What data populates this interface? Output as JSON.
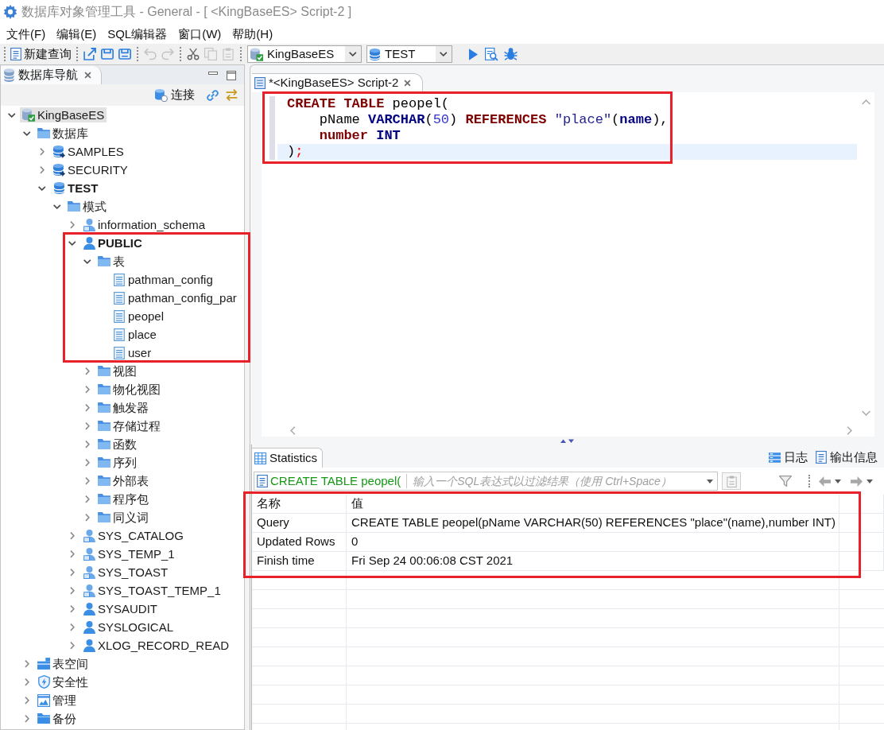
{
  "window": {
    "title": "数据库对象管理工具 - General - [ <KingBaseES> Script-2 ]"
  },
  "menu": [
    "文件(F)",
    "编辑(E)",
    "SQL编辑器",
    "窗口(W)",
    "帮助(H)"
  ],
  "toolbar": {
    "new_query": "新建查询",
    "groups": [
      [
        {
          "kind": "export",
          "disabled": false
        },
        {
          "kind": "save",
          "disabled": false
        },
        {
          "kind": "save_all",
          "disabled": false
        }
      ],
      [
        {
          "kind": "undo",
          "disabled": true
        },
        {
          "kind": "redo",
          "disabled": true
        }
      ],
      [
        {
          "kind": "cut",
          "disabled": false
        },
        {
          "kind": "copy",
          "disabled": true
        },
        {
          "kind": "paste",
          "disabled": true
        }
      ]
    ],
    "connection": "KingBaseES",
    "database": "TEST"
  },
  "navigator": {
    "tabs": [
      {
        "label": "数据库导航",
        "selected": true
      }
    ],
    "connect": "连接",
    "tree": [
      {
        "label": "KingBaseES",
        "kind": "server",
        "expanded": true,
        "selected": true,
        "children": [
          {
            "label": "数据库",
            "kind": "folder",
            "expanded": true,
            "selected": false,
            "children": [
              {
                "label": "SAMPLES",
                "kind": "database",
                "expanded": false,
                "selected": false,
                "active": false
              },
              {
                "label": "SECURITY",
                "kind": "database",
                "expanded": false,
                "selected": false,
                "active": false
              },
              {
                "label": "TEST",
                "kind": "database",
                "expanded": true,
                "selected": false,
                "active": true,
                "children": [
                  {
                    "label": "模式",
                    "kind": "folder",
                    "expanded": true,
                    "selected": false,
                    "children": [
                      {
                        "label": "information_schema",
                        "kind": "sysschema",
                        "expanded": false,
                        "selected": false,
                        "active": false
                      },
                      {
                        "label": "PUBLIC",
                        "kind": "schema",
                        "expanded": true,
                        "selected": false,
                        "active": true,
                        "children": [
                          {
                            "label": "表",
                            "kind": "folder",
                            "expanded": true,
                            "selected": false,
                            "children": [
                              {
                                "label": "pathman_config",
                                "kind": "table",
                                "selected": false
                              },
                              {
                                "label": "pathman_config_par",
                                "kind": "table",
                                "selected": false
                              },
                              {
                                "label": "peopel",
                                "kind": "table",
                                "selected": false
                              },
                              {
                                "label": "place",
                                "kind": "table",
                                "selected": false
                              },
                              {
                                "label": "user",
                                "kind": "table",
                                "selected": false
                              }
                            ]
                          },
                          {
                            "label": "视图",
                            "kind": "folder",
                            "expanded": false,
                            "selected": false
                          },
                          {
                            "label": "物化视图",
                            "kind": "folder",
                            "expanded": false,
                            "selected": false
                          },
                          {
                            "label": "触发器",
                            "kind": "folder",
                            "expanded": false,
                            "selected": false
                          },
                          {
                            "label": "存储过程",
                            "kind": "folder",
                            "expanded": false,
                            "selected": false
                          },
                          {
                            "label": "函数",
                            "kind": "folder",
                            "expanded": false,
                            "selected": false
                          },
                          {
                            "label": "序列",
                            "kind": "folder",
                            "expanded": false,
                            "selected": false
                          },
                          {
                            "label": "外部表",
                            "kind": "folder",
                            "expanded": false,
                            "selected": false
                          },
                          {
                            "label": "程序包",
                            "kind": "folder",
                            "expanded": false,
                            "selected": false
                          },
                          {
                            "label": "同义词",
                            "kind": "folder",
                            "expanded": false,
                            "selected": false
                          }
                        ]
                      },
                      {
                        "label": "SYS_CATALOG",
                        "kind": "sysschema",
                        "expanded": false,
                        "selected": false,
                        "active": false
                      },
                      {
                        "label": "SYS_TEMP_1",
                        "kind": "sysschema",
                        "expanded": false,
                        "selected": false,
                        "active": false
                      },
                      {
                        "label": "SYS_TOAST",
                        "kind": "sysschema",
                        "expanded": false,
                        "selected": false,
                        "active": false
                      },
                      {
                        "label": "SYS_TOAST_TEMP_1",
                        "kind": "sysschema",
                        "expanded": false,
                        "selected": false,
                        "active": false
                      },
                      {
                        "label": "SYSAUDIT",
                        "kind": "schema",
                        "expanded": false,
                        "selected": false,
                        "active": false
                      },
                      {
                        "label": "SYSLOGICAL",
                        "kind": "schema",
                        "expanded": false,
                        "selected": false,
                        "active": false
                      },
                      {
                        "label": "XLOG_RECORD_READ",
                        "kind": "schema",
                        "expanded": false,
                        "selected": false,
                        "active": false
                      }
                    ]
                  }
                ]
              }
            ]
          },
          {
            "label": "表空间",
            "kind": "tablespace",
            "expanded": false,
            "selected": false
          },
          {
            "label": "安全性",
            "kind": "security",
            "expanded": false,
            "selected": false
          },
          {
            "label": "管理",
            "kind": "admin",
            "expanded": false,
            "selected": false
          },
          {
            "label": "备份",
            "kind": "backup",
            "expanded": false,
            "selected": false
          }
        ]
      }
    ]
  },
  "editor": {
    "tabs": [
      {
        "label": "*<KingBaseES> Script-2",
        "selected": true
      }
    ],
    "lines": [
      {
        "current": false,
        "tokens": [
          {
            "text": "CREATE TABLE",
            "kind": "keyword"
          },
          {
            "text": " peopel(",
            "kind": "plain"
          }
        ],
        "children": [
          {
            "current": false,
            "tokens": [
              {
                "text": "pName ",
                "kind": "plain"
              },
              {
                "text": "VARCHAR",
                "kind": "datatype"
              },
              {
                "text": "(",
                "kind": "plain"
              },
              {
                "text": "50",
                "kind": "number"
              },
              {
                "text": ") ",
                "kind": "plain"
              },
              {
                "text": "REFERENCES",
                "kind": "keyword"
              },
              {
                "text": " \"place\"",
                "kind": "string"
              },
              {
                "text": "(",
                "kind": "plain"
              },
              {
                "text": "name",
                "kind": "datatype"
              },
              {
                "text": "),",
                "kind": "plain"
              }
            ]
          },
          {
            "current": false,
            "tokens": [
              {
                "text": "number",
                "kind": "keyword"
              },
              {
                "text": " INT",
                "kind": "datatype"
              }
            ]
          }
        ]
      },
      {
        "current": true,
        "tokens": [
          {
            "text": ")",
            "kind": "plain"
          },
          {
            "text": ";",
            "kind": "terminator"
          }
        ]
      }
    ]
  },
  "results": {
    "tabs": [
      {
        "label": "Statistics",
        "selected": true
      }
    ],
    "views": [
      {
        "label": "日志",
        "kind": "log"
      },
      {
        "label": "输出信息",
        "kind": "output"
      }
    ],
    "filter": {
      "query": "CREATE TABLE peopel(",
      "placeholder": "输入一个SQL表达式以过滤结果（使用 Ctrl+Space）"
    },
    "table": {
      "columns": [
        "名称",
        "值"
      ],
      "rows": [
        [
          "Query",
          "CREATE TABLE peopel(pName VARCHAR(50) REFERENCES \"place\"(name),number INT)"
        ],
        [
          "Updated Rows",
          "0"
        ],
        [
          "Finish time",
          "Fri Sep 24 00:06:08 CST 2021"
        ]
      ]
    }
  }
}
